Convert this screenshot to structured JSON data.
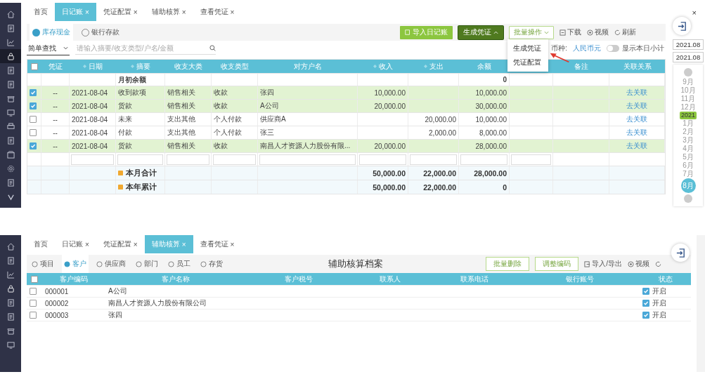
{
  "journal": {
    "sidebar": [
      {
        "selected": false
      },
      {
        "selected": false
      },
      {
        "selected": false
      },
      {
        "selected": true
      },
      {
        "selected": false
      },
      {
        "selected": false
      },
      {
        "selected": false
      },
      {
        "selected": false
      },
      {
        "selected": false
      },
      {
        "selected": false
      },
      {
        "selected": false
      },
      {
        "selected": false
      },
      {
        "selected": false
      },
      {
        "selected": false
      }
    ],
    "tabs": [
      {
        "label": "首页",
        "selected": false
      },
      {
        "label": "日记账",
        "close": "×",
        "selected": true
      },
      {
        "label": "凭证配置",
        "close": "×",
        "selected": false
      },
      {
        "label": "辅助核算",
        "close": "×",
        "selected": false
      },
      {
        "label": "查看凭证",
        "close": "×",
        "selected": false
      }
    ],
    "close": "×",
    "subtabs": [
      {
        "label": "库存现金",
        "selected": true
      },
      {
        "label": "银行存款",
        "selected": false
      }
    ],
    "search": {
      "mode": "简单查找",
      "placeholder": "请输入摘要/收支类型/户名/金额"
    },
    "buttons": [
      {
        "label": "导入日记账",
        "kind": "primary"
      },
      {
        "label": "生成凭证",
        "kind": "dark",
        "expanded": true
      },
      {
        "label": "批量操作",
        "kind": "outline",
        "expanded": false
      },
      {
        "label": "下载",
        "kind": "download"
      },
      {
        "label": "视频",
        "kind": "video"
      },
      {
        "label": "刷新",
        "kind": "refresh"
      }
    ],
    "menu": [
      "生成凭证",
      "凭证配置"
    ],
    "currency": {
      "label": "币种:",
      "value": "人民币元"
    },
    "daily_subtotal": {
      "label": "显示本日小计",
      "on": false
    },
    "table": {
      "select_all": false,
      "columns": [
        {
          "label": "凭证",
          "sortable": false
        },
        {
          "label": "日期",
          "sortable": true
        },
        {
          "label": "摘要",
          "sortable": true
        },
        {
          "label": "收支大类",
          "sortable": false
        },
        {
          "label": "收支类型",
          "sortable": false
        },
        {
          "label": "对方户名",
          "sortable": false
        },
        {
          "label": "收入",
          "sortable": true
        },
        {
          "label": "支出",
          "sortable": true
        },
        {
          "label": "余额",
          "sortable": false
        },
        {
          "label": "备注",
          "sortable": false
        },
        {
          "label": "关联关系",
          "sortable": false
        }
      ],
      "opening": {
        "label": "月初余额",
        "balance": "0"
      },
      "rows": [
        {
          "checked": true,
          "cells": [
            "--",
            "2021-08-04",
            "收到款项",
            "销售相关",
            "收款",
            "张四",
            "10,000.00",
            "",
            "10,000.00",
            "",
            "去关联"
          ]
        },
        {
          "checked": true,
          "cells": [
            "--",
            "2021-08-04",
            "货款",
            "销售相关",
            "收款",
            "A公司",
            "20,000.00",
            "",
            "30,000.00",
            "",
            "去关联"
          ]
        },
        {
          "checked": false,
          "cells": [
            "--",
            "2021-08-04",
            "未来",
            "支出其他",
            "个人付款",
            "供应商A",
            "",
            "20,000.00",
            "10,000.00",
            "",
            "去关联"
          ]
        },
        {
          "checked": false,
          "cells": [
            "--",
            "2021-08-04",
            "付款",
            "支出其他",
            "个人付款",
            "张三",
            "",
            "2,000.00",
            "8,000.00",
            "",
            "去关联"
          ]
        },
        {
          "checked": true,
          "cells": [
            "--",
            "2021-08-04",
            "货款",
            "销售相关",
            "收款",
            "南昌人才资源人力股份有限...",
            "20,000.00",
            "",
            "28,000.00",
            "",
            "去关联"
          ]
        }
      ],
      "totals": [
        {
          "label": "本月合计",
          "income": "50,000.00",
          "expense": "22,000.00",
          "balance": "28,000.00"
        },
        {
          "label": "本年累计",
          "income": "50,000.00",
          "expense": "22,000.00",
          "balance": "0"
        }
      ]
    },
    "period": {
      "from": "2021.08",
      "to": "2021.08",
      "year": "2021",
      "months": [
        {
          "label": "9月",
          "selected": false
        },
        {
          "label": "10月",
          "selected": false
        },
        {
          "label": "11月",
          "selected": false
        },
        {
          "label": "12月",
          "selected": false
        },
        {
          "label": "1月",
          "selected": false
        },
        {
          "label": "2月",
          "selected": false
        },
        {
          "label": "3月",
          "selected": false
        },
        {
          "label": "4月",
          "selected": false
        },
        {
          "label": "5月",
          "selected": false
        },
        {
          "label": "6月",
          "selected": false
        },
        {
          "label": "7月",
          "selected": false
        },
        {
          "label": "8月",
          "selected": true
        }
      ]
    }
  },
  "archive": {
    "sidebar": [
      {
        "selected": false
      },
      {
        "selected": false
      },
      {
        "selected": false
      },
      {
        "selected": false
      },
      {
        "selected": false
      },
      {
        "selected": false
      },
      {
        "selected": false
      },
      {
        "selected": false
      }
    ],
    "tabs": [
      {
        "label": "首页",
        "selected": false
      },
      {
        "label": "日记账",
        "close": "×",
        "selected": false
      },
      {
        "label": "凭证配置",
        "close": "×",
        "selected": false
      },
      {
        "label": "辅助核算",
        "close": "×",
        "selected": true
      },
      {
        "label": "查看凭证",
        "close": "×",
        "selected": false
      }
    ],
    "categories": [
      {
        "label": "项目",
        "selected": false
      },
      {
        "label": "客户",
        "selected": true
      },
      {
        "label": "供应商",
        "selected": false
      },
      {
        "label": "部门",
        "selected": false
      },
      {
        "label": "员工",
        "selected": false
      },
      {
        "label": "存货",
        "selected": false
      }
    ],
    "title": "辅助核算档案",
    "buttons": [
      {
        "label": "批量删除",
        "kind": "outline"
      },
      {
        "label": "调整编码",
        "kind": "outline"
      },
      {
        "label": "导入/导出",
        "kind": "import"
      },
      {
        "label": "视频",
        "kind": "video"
      }
    ],
    "select_all": false,
    "columns": [
      "客户编码",
      "客户名称",
      "客户税号",
      "联系人",
      "联系电话",
      "银行账号",
      "状态"
    ],
    "rows": [
      {
        "checked": false,
        "code": "000001",
        "name": "A公司",
        "status": "开启",
        "enabled": true
      },
      {
        "checked": false,
        "code": "000002",
        "name": "南昌人才资源人力股份有限公司",
        "status": "开启",
        "enabled": true
      },
      {
        "checked": false,
        "code": "000003",
        "name": "张四",
        "status": "开启",
        "enabled": true
      }
    ]
  }
}
